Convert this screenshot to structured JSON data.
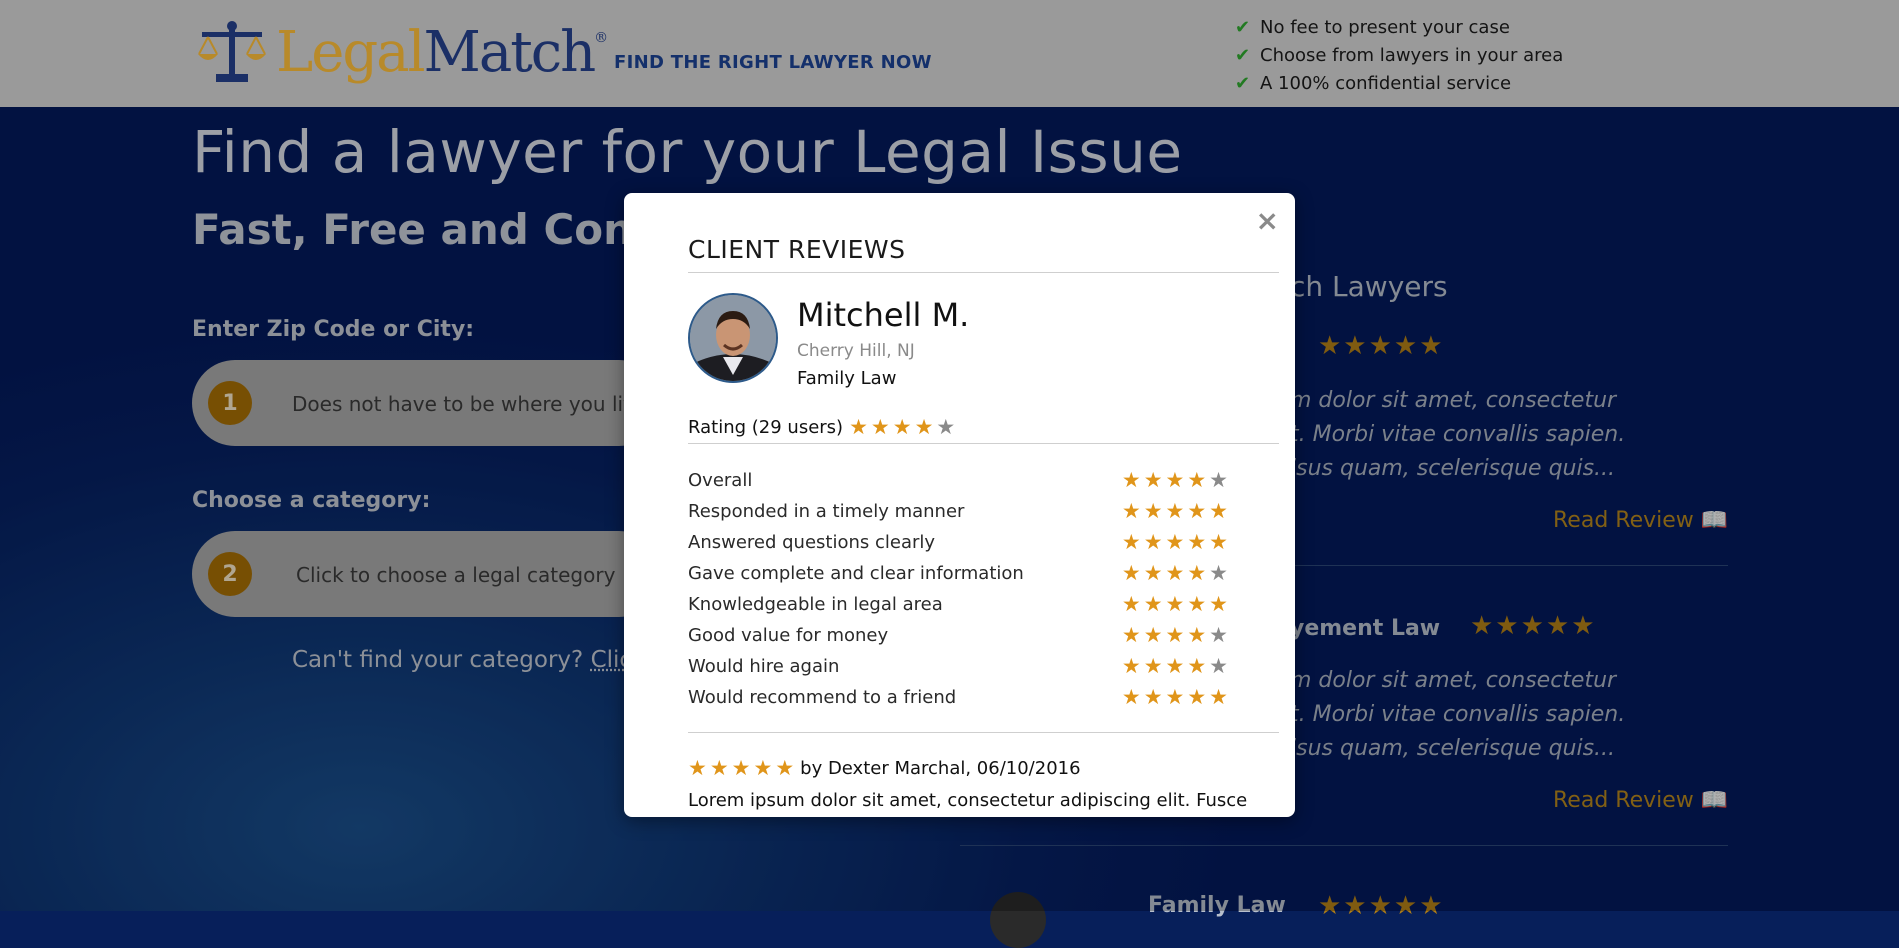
{
  "header": {
    "logo_legal": "Legal",
    "logo_match": "Match",
    "logo_reg": "®",
    "tagline": "FIND THE RIGHT LAWYER NOW",
    "benefits": [
      "No fee to present your case",
      "Choose from lawyers in your area",
      "A 100% confidential service"
    ]
  },
  "hero": {
    "title": "Find a lawyer for your Legal Issue",
    "subtitle": "Fast, Free and Conf",
    "zip_label": "Enter Zip Code or City:",
    "zip_step": "1",
    "zip_placeholder": "Does not have to be where you live",
    "category_label": "Choose a category:",
    "category_step": "2",
    "category_placeholder": "Click to choose a legal category",
    "cant_find": "Can't find your category?",
    "cant_find_link": "Clic"
  },
  "right_column": {
    "title": "ch Lawyers",
    "card1_text": [
      "m dolor sit amet, consectetur",
      "t. Morbi vitae convallis sapien.",
      "isus quam, scelerisque quis..."
    ],
    "card1_read": "Read Review",
    "card2_category": "yement Law",
    "card2_text": [
      "m dolor sit amet, consectetur",
      "t. Morbi vitae convallis sapien.",
      "isus quam, scelerisque quis..."
    ],
    "card2_read": "Read Review",
    "card3_category": "Family Law"
  },
  "modal": {
    "title": "CLIENT REVIEWS",
    "close": "×",
    "lawyer_name": "Mitchell M.",
    "location": "Cherry Hill, NJ",
    "practice_area": "Family Law",
    "rating_label": "Rating (29 users)",
    "rating_value": 4,
    "criteria": [
      {
        "label": "Overall",
        "stars": 4
      },
      {
        "label": "Responded in a timely manner",
        "stars": 5
      },
      {
        "label": "Answered questions clearly",
        "stars": 5
      },
      {
        "label": "Gave complete and clear information",
        "stars": 4
      },
      {
        "label": "Knowledgeable in legal area",
        "stars": 5
      },
      {
        "label": "Good value for money",
        "stars": 4
      },
      {
        "label": "Would hire again",
        "stars": 4
      },
      {
        "label": "Would recommend to a friend",
        "stars": 5
      }
    ],
    "review": {
      "stars": 5,
      "by": "by Dexter Marchal, 06/10/2016",
      "text": "Lorem ipsum dolor sit amet, consectetur adipiscing elit. Fusce"
    }
  },
  "colors": {
    "star_on": "#e0951a",
    "star_off": "#8a8a8a",
    "gold": "#b07e17",
    "navy": "#14306b"
  }
}
